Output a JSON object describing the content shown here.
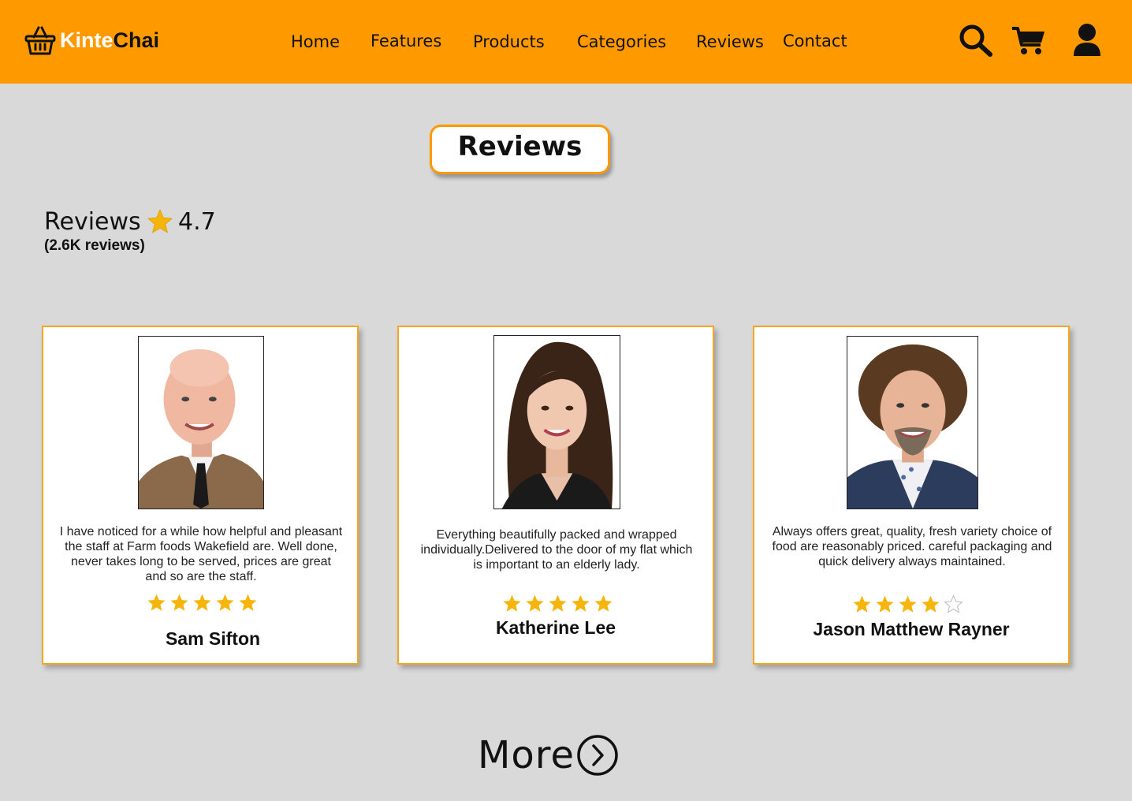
{
  "brand": {
    "name_part1": "Kinte",
    "name_part2": "Chai",
    "icon": "basket-icon"
  },
  "nav": {
    "links": [
      "Home",
      "Features",
      "Products",
      "Categories",
      "Reviews",
      "Contact"
    ],
    "icons": [
      "search-icon",
      "cart-icon",
      "user-icon"
    ]
  },
  "section": {
    "title": "Reviews"
  },
  "summary": {
    "label": "Reviews",
    "score": "4.7",
    "count": "(2.6K reviews)"
  },
  "reviews": [
    {
      "name": "Sam Sifton",
      "text": "I have noticed for a while how helpful and pleasant the staff at Farm foods Wakefield are. Well done, never takes long to be served, prices are great and so are the staff.",
      "rating": 5,
      "rating_max": 5
    },
    {
      "name": "Katherine Lee",
      "text": "Everything beautifully packed and wrapped individually.Delivered to the door of my flat which is important to an elderly lady.",
      "rating": 5,
      "rating_max": 5
    },
    {
      "name": "Jason Matthew Rayner",
      "text": "Always offers great, quality, fresh variety choice of food are reasonably priced. careful packaging and quick delivery always maintained.",
      "rating": 4,
      "rating_max": 5
    }
  ],
  "more": {
    "label": "More",
    "icon": "chevron-right-circle-icon"
  },
  "colors": {
    "accent": "#ff9900",
    "star": "#f5b50a",
    "background": "#d9d9d9"
  }
}
